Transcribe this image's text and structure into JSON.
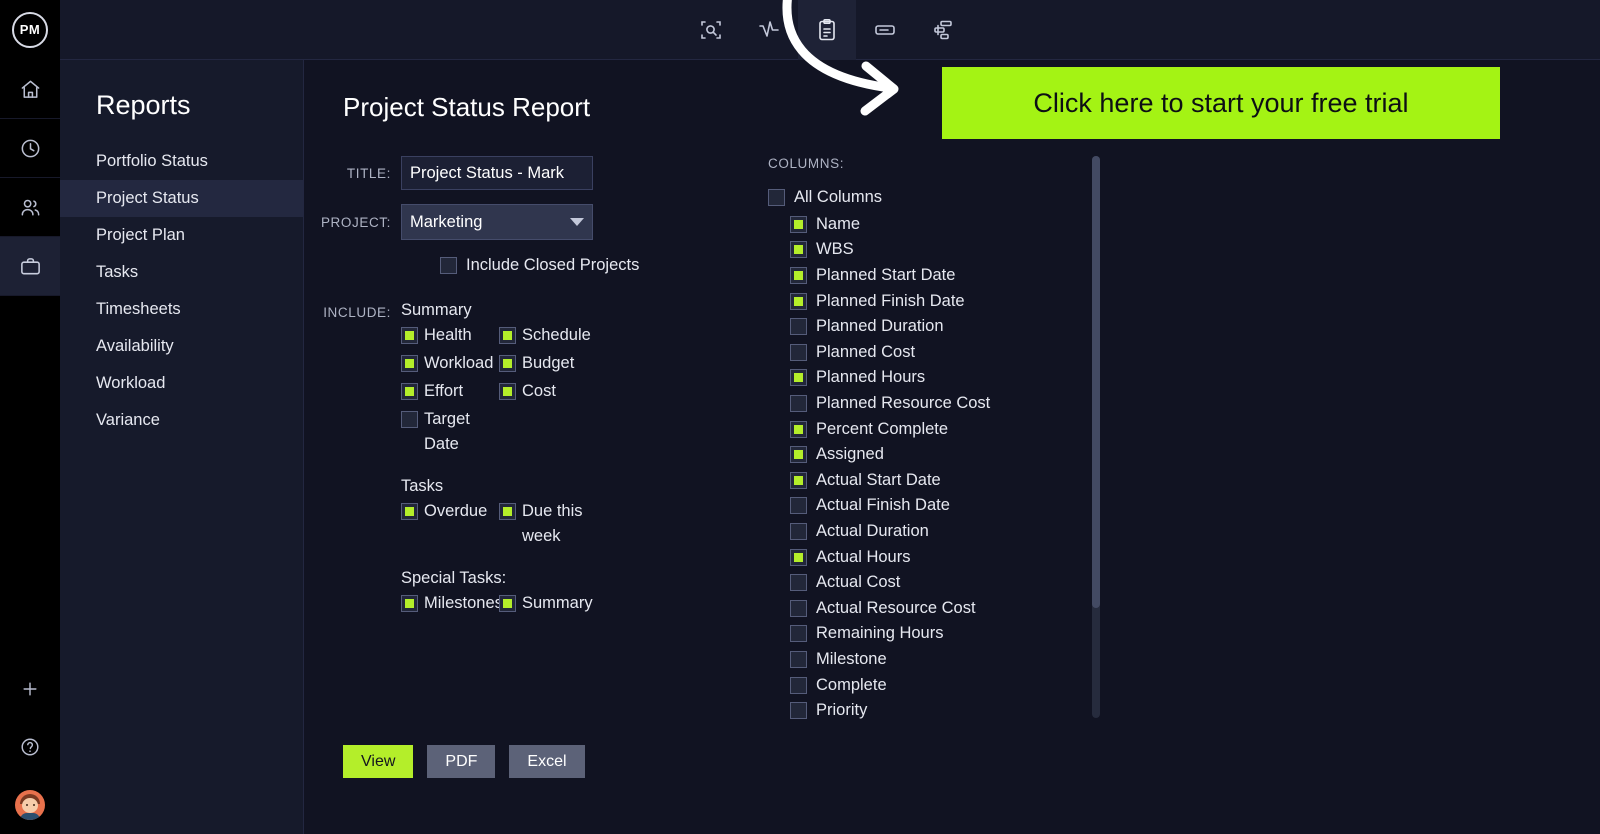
{
  "brand": {
    "logo_text": "PM"
  },
  "topbar": {
    "icons": [
      {
        "name": "scan-search-icon",
        "label": "Search"
      },
      {
        "name": "activity-pulse-icon",
        "label": "Activity"
      },
      {
        "name": "clipboard-report-icon",
        "label": "Reports",
        "active": true
      },
      {
        "name": "card-view-icon",
        "label": "Board"
      },
      {
        "name": "gantt-icon",
        "label": "Gantt"
      }
    ]
  },
  "rail": {
    "items": [
      {
        "name": "home-icon",
        "label": "Home"
      },
      {
        "name": "clock-icon",
        "label": "Timesheets"
      },
      {
        "name": "people-icon",
        "label": "Team"
      },
      {
        "name": "briefcase-icon",
        "label": "Projects",
        "active": true
      }
    ],
    "bottom": [
      {
        "name": "plus-icon",
        "label": "Add"
      },
      {
        "name": "help-icon",
        "label": "Help"
      },
      {
        "name": "avatar",
        "label": "Profile"
      }
    ]
  },
  "sidebar": {
    "title": "Reports",
    "items": [
      {
        "label": "Portfolio Status",
        "active": false
      },
      {
        "label": "Project Status",
        "active": true
      },
      {
        "label": "Project Plan",
        "active": false
      },
      {
        "label": "Tasks",
        "active": false
      },
      {
        "label": "Timesheets",
        "active": false
      },
      {
        "label": "Availability",
        "active": false
      },
      {
        "label": "Workload",
        "active": false
      },
      {
        "label": "Variance",
        "active": false
      }
    ]
  },
  "main": {
    "page_title": "Project Status Report",
    "form": {
      "title_label": "TITLE:",
      "title_value": "Project Status - Mark",
      "project_label": "PROJECT:",
      "project_value": "Marketing",
      "include_closed_label": "Include Closed Projects",
      "include_closed_checked": false,
      "include_label": "INCLUDE:"
    },
    "include_groups": [
      {
        "heading": "Summary",
        "options": [
          {
            "label": "Health",
            "checked": true
          },
          {
            "label": "Schedule",
            "checked": true
          },
          {
            "label": "Workload",
            "checked": true
          },
          {
            "label": "Budget",
            "checked": true
          },
          {
            "label": "Effort",
            "checked": true
          },
          {
            "label": "Cost",
            "checked": true
          },
          {
            "label": "Target Date",
            "checked": false
          }
        ]
      },
      {
        "heading": "Tasks",
        "options": [
          {
            "label": "Overdue",
            "checked": true
          },
          {
            "label": "Due this week",
            "checked": true
          }
        ]
      },
      {
        "heading": "Special Tasks:",
        "options": [
          {
            "label": "Milestones",
            "checked": true
          },
          {
            "label": "Summary",
            "checked": true
          }
        ]
      }
    ],
    "columns": {
      "heading": "COLUMNS:",
      "all_label": "All Columns",
      "all_checked": false,
      "items": [
        {
          "label": "Name",
          "checked": true
        },
        {
          "label": "WBS",
          "checked": true
        },
        {
          "label": "Planned Start Date",
          "checked": true
        },
        {
          "label": "Planned Finish Date",
          "checked": true
        },
        {
          "label": "Planned Duration",
          "checked": false
        },
        {
          "label": "Planned Cost",
          "checked": false
        },
        {
          "label": "Planned Hours",
          "checked": true
        },
        {
          "label": "Planned Resource Cost",
          "checked": false
        },
        {
          "label": "Percent Complete",
          "checked": true
        },
        {
          "label": "Assigned",
          "checked": true
        },
        {
          "label": "Actual Start Date",
          "checked": true
        },
        {
          "label": "Actual Finish Date",
          "checked": false
        },
        {
          "label": "Actual Duration",
          "checked": false
        },
        {
          "label": "Actual Hours",
          "checked": true
        },
        {
          "label": "Actual Cost",
          "checked": false
        },
        {
          "label": "Actual Resource Cost",
          "checked": false
        },
        {
          "label": "Remaining Hours",
          "checked": false
        },
        {
          "label": "Milestone",
          "checked": false
        },
        {
          "label": "Complete",
          "checked": false
        },
        {
          "label": "Priority",
          "checked": false
        }
      ]
    },
    "actions": [
      {
        "label": "View",
        "style": "view"
      },
      {
        "label": "PDF",
        "style": "sec"
      },
      {
        "label": "Excel",
        "style": "sec"
      }
    ]
  },
  "promo": {
    "cta_text": "Click here to start your free trial",
    "cta_bg": "#a4f314",
    "arrow_color": "#ffffff"
  },
  "colors": {
    "accent_green": "#b4ee2a",
    "bg_main": "#111322",
    "bg_sidebar": "#161a2b",
    "bg_topbar": "#151829",
    "rail": "#000000"
  }
}
